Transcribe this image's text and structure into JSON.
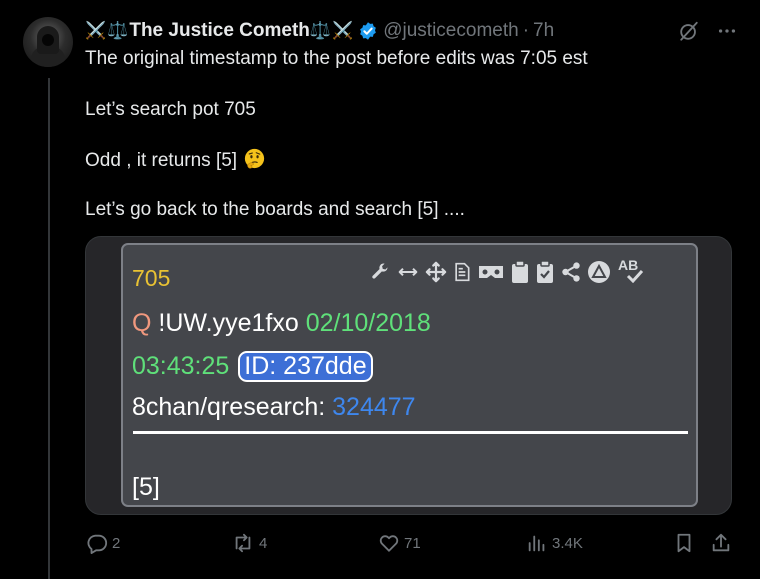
{
  "post": {
    "display_name": "The Justice Cometh",
    "emoji_sword": "⚔️",
    "emoji_scale": "⚖️",
    "handle": "@justicecometh",
    "separator": "·",
    "time": "7h",
    "lines": [
      "The original timestamp to the post before edits was 7:05 est",
      "Let’s search pot 705",
      "Odd , it returns [5]",
      "Let’s go back to the boards and search [5] ...."
    ]
  },
  "media_note": {
    "pot": "705",
    "q_prefix": "Q",
    "tripcode": "!UW.yye1fxo",
    "date": "02/10/2018",
    "time": "03:43:25",
    "id": "ID: 237dde",
    "board": "8chan/qresearch:",
    "post_number": "324477",
    "result": "[5]",
    "ab_label": "AB"
  },
  "actions": {
    "replies": "2",
    "reposts": "4",
    "likes": "71",
    "views": "3.4K"
  },
  "colors": {
    "background": "#000000",
    "verified": "#1d9bf0",
    "muted": "#71767b",
    "pot_yellow": "#e9c233",
    "q_salmon": "#f0987e",
    "green": "#5fe07a",
    "blue": "#3e87ee"
  }
}
